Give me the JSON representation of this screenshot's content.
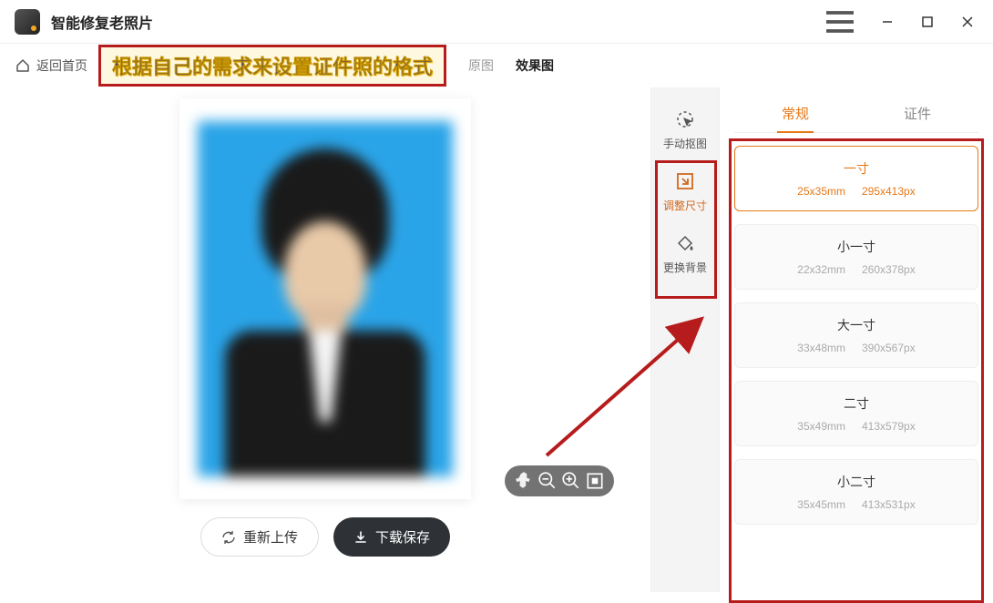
{
  "app": {
    "title": "智能修复老照片"
  },
  "toolbar": {
    "back": "返回首页",
    "tabs": {
      "original": "原图",
      "result": "效果图"
    }
  },
  "annotation": {
    "banner": "根据自己的需求来设置证件照的格式"
  },
  "tools": {
    "manual_cutout": "手动抠图",
    "resize": "调整尺寸",
    "change_bg": "更换背景"
  },
  "panel": {
    "tabs": {
      "regular": "常规",
      "idcard": "证件"
    },
    "sizes": [
      {
        "name": "一寸",
        "mm": "25x35mm",
        "px": "295x413px",
        "selected": true
      },
      {
        "name": "小一寸",
        "mm": "22x32mm",
        "px": "260x378px",
        "selected": false
      },
      {
        "name": "大一寸",
        "mm": "33x48mm",
        "px": "390x567px",
        "selected": false
      },
      {
        "name": "二寸",
        "mm": "35x49mm",
        "px": "413x579px",
        "selected": false
      },
      {
        "name": "小二寸",
        "mm": "35x45mm",
        "px": "413x531px",
        "selected": false
      }
    ]
  },
  "actions": {
    "reupload": "重新上传",
    "save": "下载保存"
  },
  "colors": {
    "accent": "#e67817",
    "highlight": "#b71c1c"
  }
}
